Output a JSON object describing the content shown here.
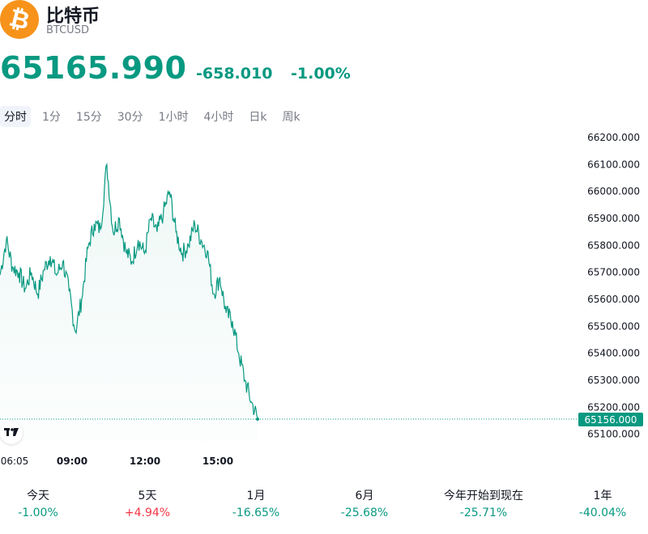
{
  "header": {
    "coin_name": "比特币",
    "symbol": "BTCUSD",
    "price": "65165.990",
    "change": "-658.010",
    "change_percent": "-1.00%",
    "logo_icon": "bitcoin-icon",
    "logo_color": "#f7931a",
    "price_color": "#089981"
  },
  "intervals": {
    "active": 0,
    "items": [
      "分时",
      "1分",
      "15分",
      "30分",
      "1小时",
      "4小时",
      "日k",
      "周k"
    ]
  },
  "chart_data": {
    "type": "area",
    "y_ticks": [
      "66200.000",
      "66100.000",
      "66000.000",
      "65900.000",
      "65800.000",
      "65700.000",
      "65600.000",
      "65500.000",
      "65400.000",
      "65300.000",
      "65200.000",
      "65100.000"
    ],
    "x_ticks": [
      "06:05",
      "09:00",
      "12:00",
      "15:00"
    ],
    "current_price_label": "65156.000",
    "ylim": [
      65075,
      66230
    ],
    "line_color": "#089981",
    "x": [
      "06:05",
      "06:20",
      "06:35",
      "06:50",
      "07:05",
      "07:20",
      "07:35",
      "07:50",
      "08:05",
      "08:20",
      "08:35",
      "08:50",
      "09:05",
      "09:20",
      "09:35",
      "09:50",
      "10:05",
      "10:20",
      "10:35",
      "10:50",
      "11:05",
      "11:20",
      "11:35",
      "11:50",
      "12:05",
      "12:20",
      "12:35",
      "12:50",
      "13:05",
      "13:20",
      "13:35",
      "13:50",
      "14:05",
      "14:20",
      "14:35",
      "14:50",
      "15:05",
      "15:20",
      "15:35",
      "15:50",
      "16:05",
      "16:15"
    ],
    "values": [
      65690,
      65820,
      65720,
      65700,
      65640,
      65700,
      65620,
      65710,
      65760,
      65690,
      65740,
      65630,
      65480,
      65600,
      65790,
      65880,
      65860,
      66100,
      65850,
      65900,
      65780,
      65740,
      65820,
      65770,
      65900,
      65850,
      65920,
      66000,
      65850,
      65770,
      65800,
      65880,
      65820,
      65780,
      65620,
      65680,
      65550,
      65520,
      65400,
      65300,
      65220,
      65160
    ]
  },
  "performance": [
    {
      "label": "今天",
      "value": "-1.00%",
      "color": "#089981"
    },
    {
      "label": "5天",
      "value": "+4.94%",
      "color": "#f23645"
    },
    {
      "label": "1月",
      "value": "-16.65%",
      "color": "#089981"
    },
    {
      "label": "6月",
      "value": "-25.68%",
      "color": "#089981"
    },
    {
      "label": "今年开始到现在",
      "value": "-25.71%",
      "color": "#089981"
    },
    {
      "label": "1年",
      "value": "-40.04%",
      "color": "#089981"
    }
  ]
}
